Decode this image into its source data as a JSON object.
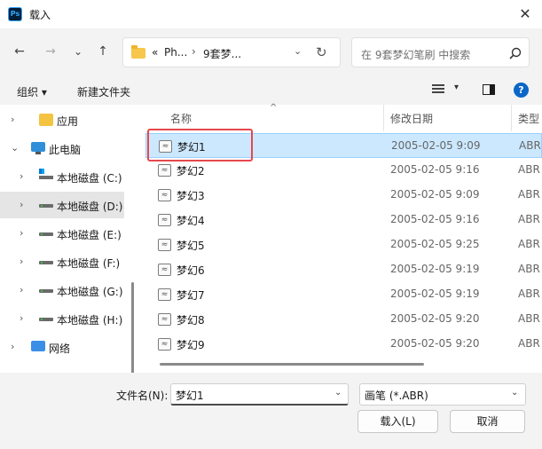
{
  "window": {
    "app_icon": "Ps",
    "title": "载入",
    "close_glyph": "✕"
  },
  "navbar": {
    "back_glyph": "←",
    "forward_glyph": "→",
    "recent_glyph": "⌄",
    "up_glyph": "↑",
    "breadcrumb": [
      "«",
      "Ph...",
      "›",
      "9套梦..."
    ],
    "dropdown_glyph": "⌄",
    "refresh_glyph": "↻",
    "search_placeholder": "在 9套梦幻笔刷 中搜索"
  },
  "toolbar": {
    "organize_label": "组织 ▾",
    "new_folder_label": "新建文件夹",
    "view_caret": "▾",
    "help_glyph": "?"
  },
  "nav_pane": {
    "items": [
      {
        "label": "应用",
        "arrow": "›",
        "icon": "app-folder-icon"
      },
      {
        "label": "此电脑",
        "arrow": "⌄",
        "icon": "computer-icon"
      },
      {
        "label": "本地磁盘 (C:)",
        "arrow": "›",
        "icon": "system-drive-icon"
      },
      {
        "label": "本地磁盘 (D:)",
        "arrow": "›",
        "icon": "drive-icon",
        "selected": true
      },
      {
        "label": "本地磁盘 (E:)",
        "arrow": "›",
        "icon": "drive-icon"
      },
      {
        "label": "本地磁盘 (F:)",
        "arrow": "›",
        "icon": "drive-icon"
      },
      {
        "label": "本地磁盘 (G:)",
        "arrow": "›",
        "icon": "drive-icon"
      },
      {
        "label": "本地磁盘 (H:)",
        "arrow": "›",
        "icon": "drive-icon"
      },
      {
        "label": "网络",
        "arrow": "›",
        "icon": "network-icon"
      }
    ]
  },
  "file_list": {
    "columns": {
      "name": "名称",
      "date": "修改日期",
      "type": "类型"
    },
    "sort_glyph": "^",
    "file_icon_glyph": "≈",
    "files": [
      {
        "name": "梦幻1",
        "date": "2005-02-05 9:09",
        "type": "ABR",
        "selected": true
      },
      {
        "name": "梦幻2",
        "date": "2005-02-05 9:16",
        "type": "ABR"
      },
      {
        "name": "梦幻3",
        "date": "2005-02-05 9:09",
        "type": "ABR"
      },
      {
        "name": "梦幻4",
        "date": "2005-02-05 9:16",
        "type": "ABR"
      },
      {
        "name": "梦幻5",
        "date": "2005-02-05 9:25",
        "type": "ABR"
      },
      {
        "name": "梦幻6",
        "date": "2005-02-05 9:19",
        "type": "ABR"
      },
      {
        "name": "梦幻7",
        "date": "2005-02-05 9:19",
        "type": "ABR"
      },
      {
        "name": "梦幻8",
        "date": "2005-02-05 9:20",
        "type": "ABR"
      },
      {
        "name": "梦幻9",
        "date": "2005-02-05 9:20",
        "type": "ABR"
      }
    ]
  },
  "footer": {
    "filename_label": "文件名(N):",
    "filename_value": "梦幻1",
    "filetype_value": "画笔 (*.ABR)",
    "dropdown_glyph": "⌄",
    "load_button": "载入(L)",
    "cancel_button": "取消"
  },
  "colors": {
    "highlight_box": "#e5484d",
    "selected_row": "#cce8ff",
    "help_blue": "#0a66c8"
  }
}
